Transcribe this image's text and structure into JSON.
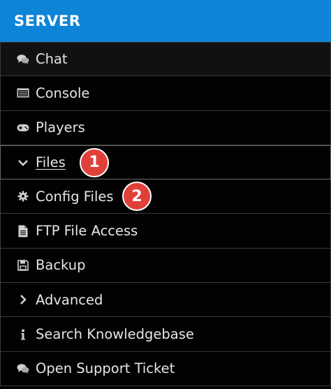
{
  "header": {
    "title": "SERVER"
  },
  "menu": {
    "items": [
      {
        "label": "Chat",
        "icon": "chat-icon"
      },
      {
        "label": "Console",
        "icon": "console-icon"
      },
      {
        "label": "Players",
        "icon": "gamepad-icon"
      },
      {
        "label": "Files",
        "icon": "chevron-down-icon",
        "badge": "1"
      },
      {
        "label": "Config Files",
        "icon": "gear-icon",
        "badge": "2"
      },
      {
        "label": "FTP File Access",
        "icon": "file-icon"
      },
      {
        "label": "Backup",
        "icon": "floppy-icon"
      },
      {
        "label": "Advanced",
        "icon": "chevron-right-icon"
      },
      {
        "label": "Search Knowledgebase",
        "icon": "info-icon"
      },
      {
        "label": "Open Support Ticket",
        "icon": "chat-icon"
      }
    ]
  },
  "colors": {
    "header_bg": "#0d84d6",
    "badge_bg": "#e0403a",
    "text": "#e6e6e6",
    "panel_bg": "#000000"
  }
}
